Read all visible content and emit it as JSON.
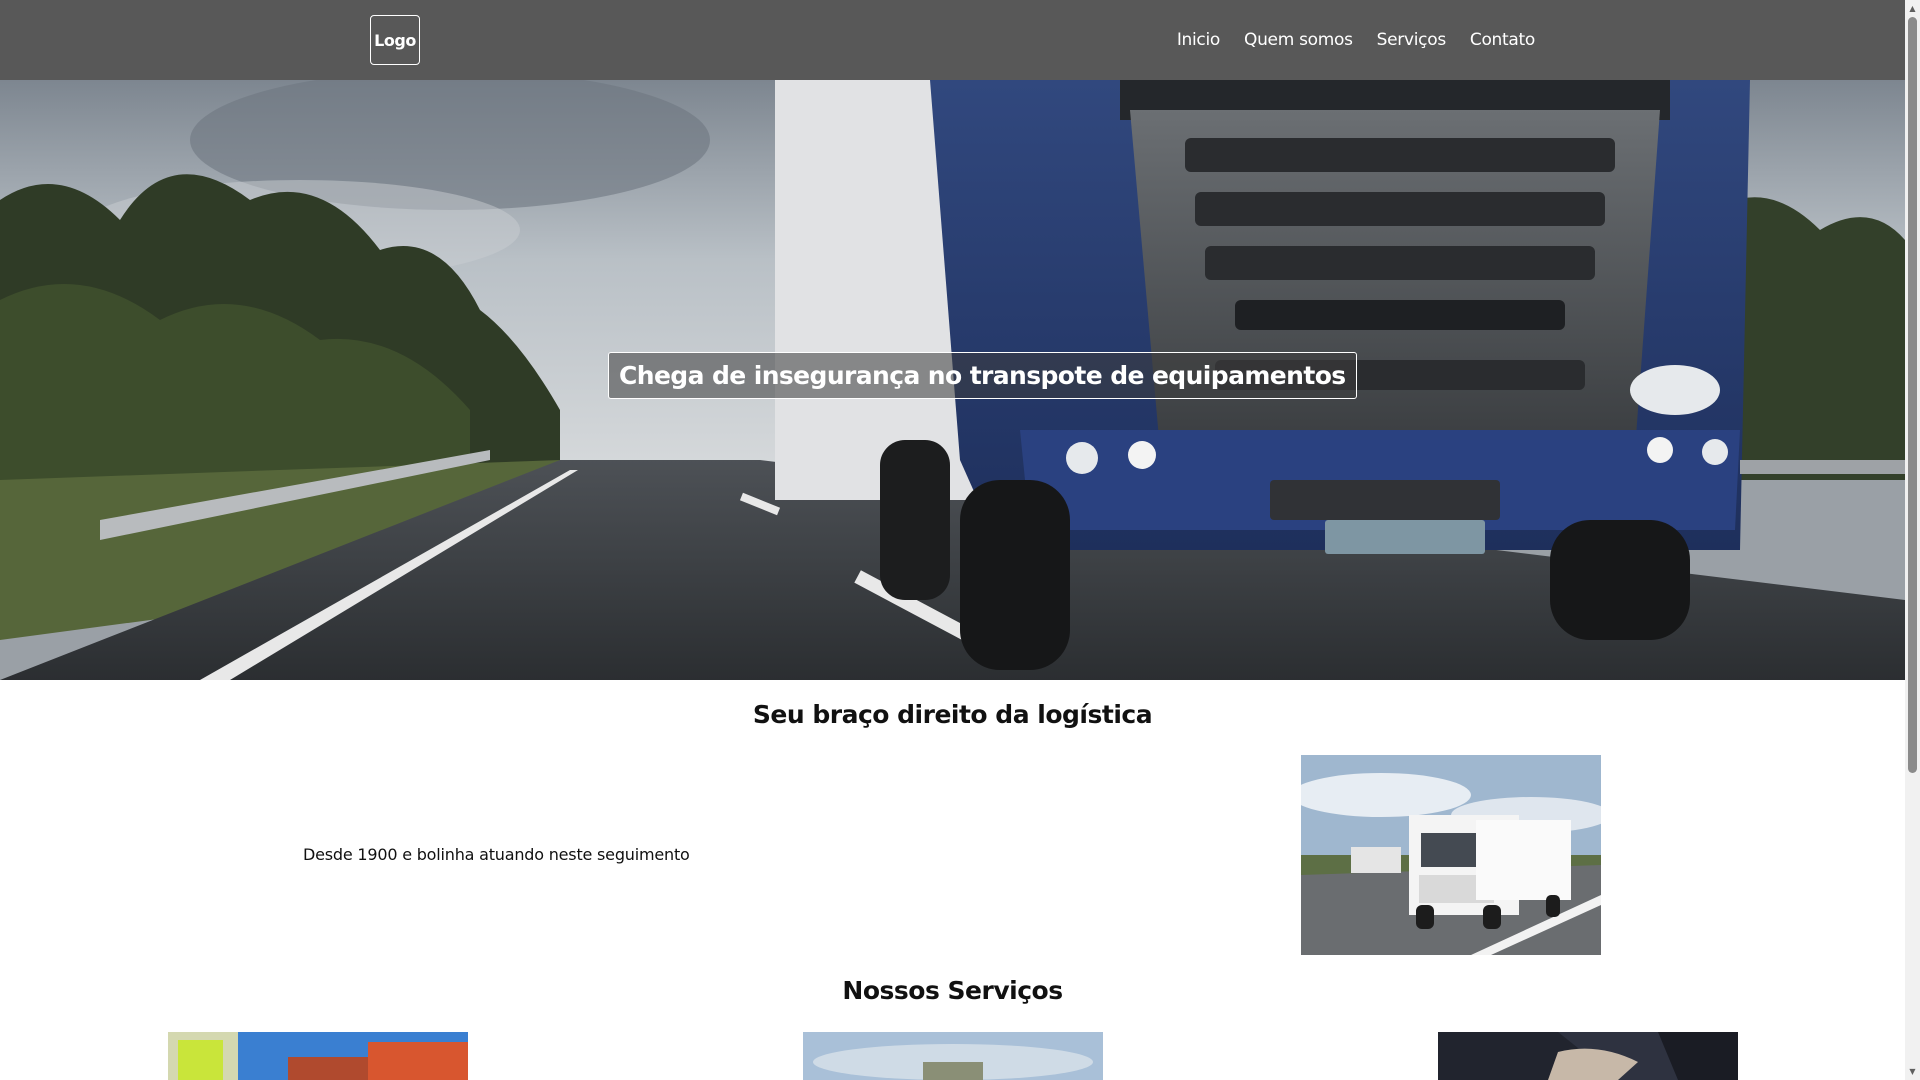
{
  "header": {
    "logo_text": "Logo",
    "nav": [
      {
        "label": "Inicio"
      },
      {
        "label": "Quem somos"
      },
      {
        "label": "Serviços"
      },
      {
        "label": "Contato"
      }
    ],
    "background_color": "#585858"
  },
  "hero": {
    "caption": "Chega de insegurança no transpote de equipamentos",
    "image": "blue-truck-on-highway"
  },
  "about": {
    "title": "Seu braço direito da logística",
    "text": "Desde 1900 e bolinha atuando neste seguimento",
    "image": "white-truck-on-road"
  },
  "services": {
    "title": "Nossos Serviços",
    "cards": [
      {
        "image": "worker-with-containers"
      },
      {
        "image": "cargo-port-sky"
      },
      {
        "image": "handshake"
      }
    ]
  }
}
